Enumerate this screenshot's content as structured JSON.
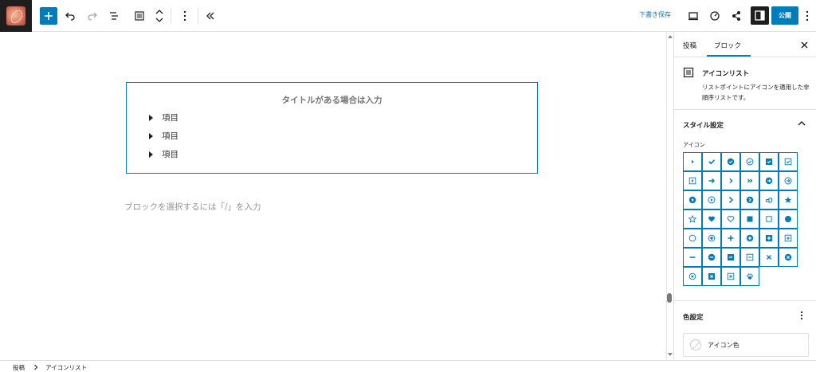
{
  "toolbar": {
    "save_draft_label": "下書き保存",
    "publish_label": "公開",
    "accent_color": "#007cba",
    "icons": [
      "plus-icon",
      "undo-icon",
      "redo-icon",
      "list-view-icon",
      "block-icon",
      "move-icon",
      "more-vertical-icon",
      "collapse-icon",
      "preview-desktop-icon",
      "performance-icon",
      "share-icon",
      "settings-sidebar-icon",
      "more-vertical-icon"
    ]
  },
  "canvas": {
    "block_title": "タイトルがある場合は入力",
    "items": [
      "項目",
      "項目",
      "項目"
    ],
    "placeholder": "ブロックを選択するには「/」を入力"
  },
  "sidebar": {
    "tabs": [
      "投稿",
      "ブロック"
    ],
    "active_tab": "ブロック",
    "block_name": "アイコンリスト",
    "block_description": "リストポイントにアイコンを適用した非順序リストです。",
    "style_section_title": "スタイル設定",
    "icon_label": "アイコン",
    "icon_options": [
      "caret-right-icon",
      "check-icon",
      "check-circle-filled-icon",
      "check-circle-outline-icon",
      "checkbox-filled-icon",
      "checkbox-outline-icon",
      "arrow-box-icon",
      "arrow-right-icon",
      "chevron-right-icon",
      "double-chevron-right-icon",
      "arrow-circle-filled-icon",
      "arrow-circle-outline-icon",
      "play-circle-filled-icon",
      "play-circle-outline-icon",
      "caret-right-large-icon",
      "chevron-circle-filled-icon",
      "hand-point-icon",
      "star-filled-icon",
      "star-outline-icon",
      "heart-filled-icon",
      "heart-outline-icon",
      "square-filled-icon",
      "square-outline-icon",
      "circle-filled-icon",
      "circle-outline-icon",
      "dot-circle-icon",
      "plus-icon",
      "plus-circle-filled-icon",
      "plus-square-filled-icon",
      "plus-square-outline-icon",
      "minus-icon",
      "minus-circle-filled-icon",
      "minus-square-filled-icon",
      "minus-square-outline-icon",
      "times-icon",
      "times-circle-filled-icon",
      "times-circle-outline-icon",
      "times-square-filled-icon",
      "times-square-outline-icon",
      "paw-icon"
    ],
    "color_section_title": "色設定",
    "color_option_label": "アイコン色"
  },
  "footer": {
    "breadcrumb": [
      "投稿",
      "アイコンリスト"
    ]
  }
}
